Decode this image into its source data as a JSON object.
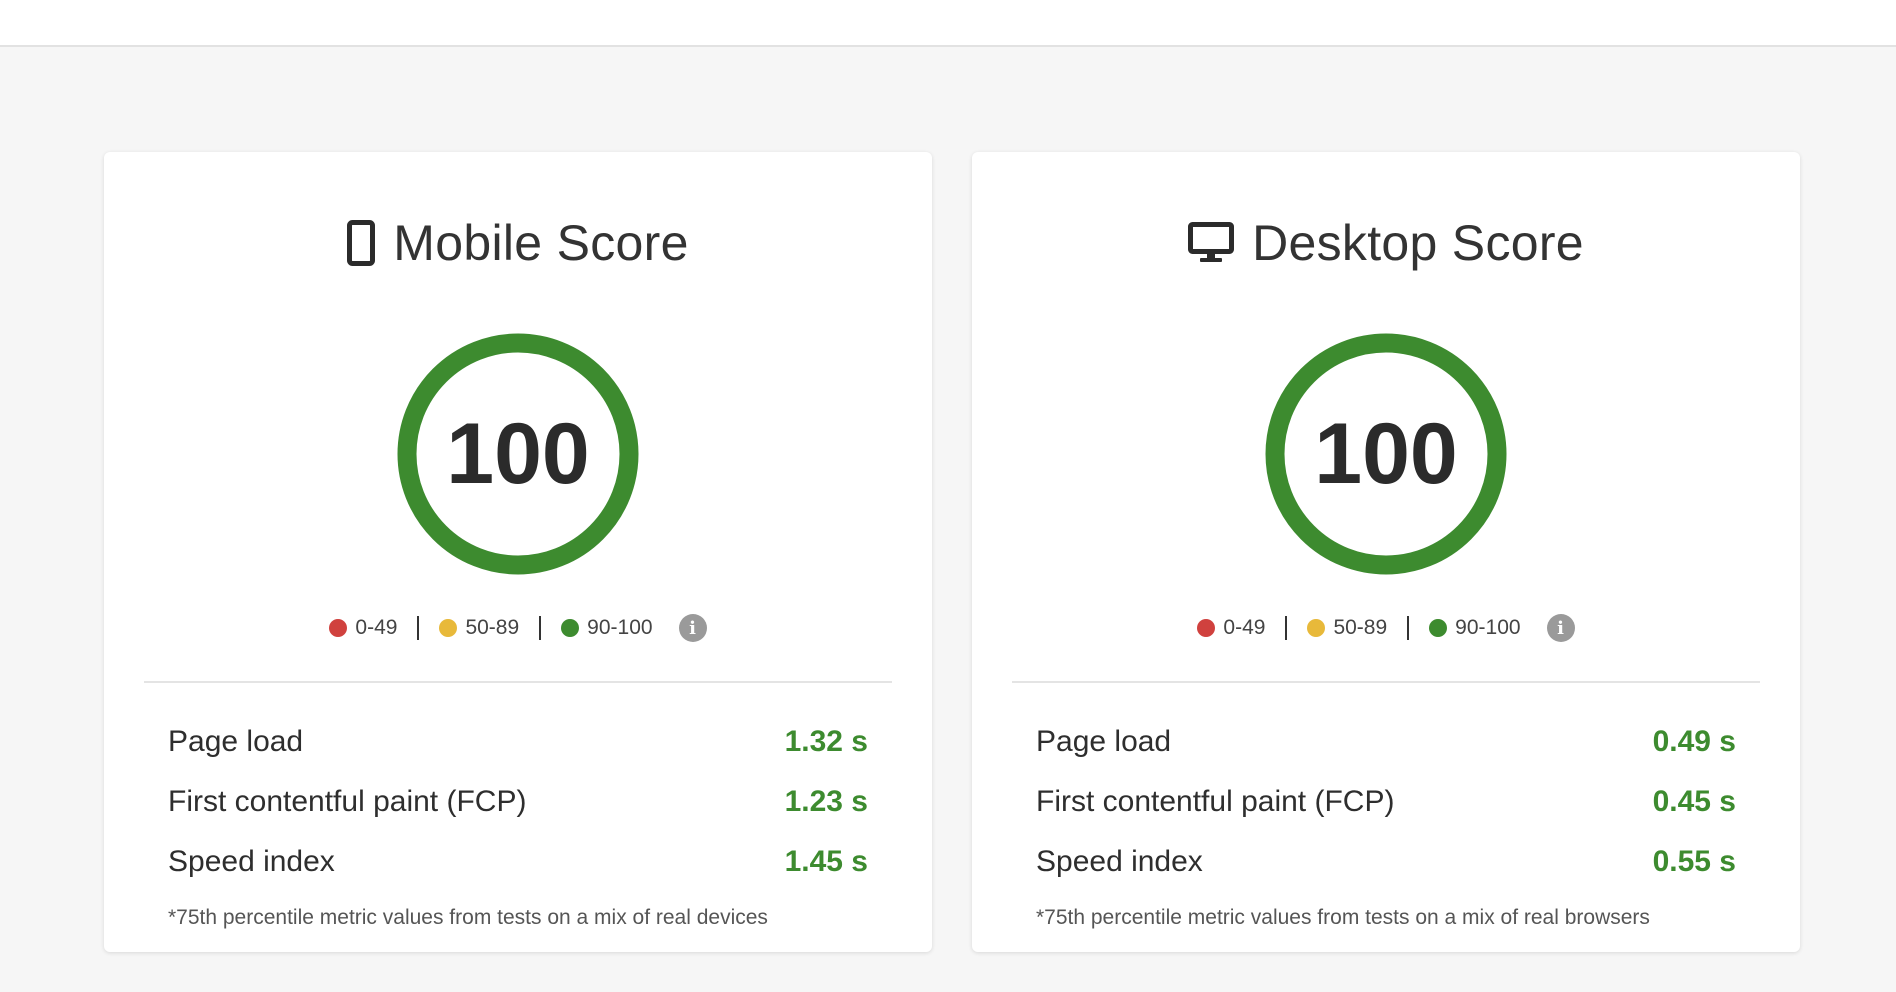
{
  "colors": {
    "good": "#3d8b2f",
    "average": "#e8b93a",
    "poor": "#d0413e",
    "info": "#9a9a9a"
  },
  "legend": {
    "poor": "0-49",
    "average": "50-89",
    "good": "90-100",
    "info_icon": "i"
  },
  "mobile": {
    "icon": "mobile-phone-icon",
    "title": "Mobile Score",
    "score": "100",
    "metrics": [
      {
        "label": "Page load",
        "value": "1.32 s"
      },
      {
        "label": "First contentful paint (FCP)",
        "value": "1.23 s"
      },
      {
        "label": "Speed index",
        "value": "1.45 s"
      }
    ],
    "footnote": "*75th percentile metric values from tests on a mix of real devices"
  },
  "desktop": {
    "icon": "desktop-monitor-icon",
    "title": "Desktop Score",
    "score": "100",
    "metrics": [
      {
        "label": "Page load",
        "value": "0.49 s"
      },
      {
        "label": "First contentful paint (FCP)",
        "value": "0.45 s"
      },
      {
        "label": "Speed index",
        "value": "0.55 s"
      }
    ],
    "footnote": "*75th percentile metric values from tests on a mix of real browsers"
  }
}
